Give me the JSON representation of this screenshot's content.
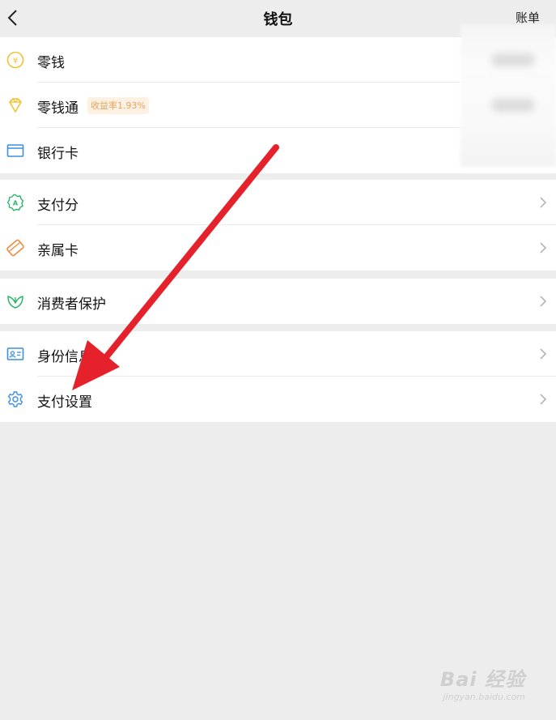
{
  "nav": {
    "title": "钱包",
    "right_action": "账单"
  },
  "sections": [
    {
      "items": [
        {
          "label": "零钱",
          "icon": "coin-icon"
        },
        {
          "label": "零钱通",
          "icon": "diamond-icon",
          "badge": "收益率1.93%"
        },
        {
          "label": "银行卡",
          "icon": "bank-card-icon"
        }
      ]
    },
    {
      "items": [
        {
          "label": "支付分",
          "icon": "payscore-icon"
        },
        {
          "label": "亲属卡",
          "icon": "family-card-icon"
        }
      ]
    },
    {
      "items": [
        {
          "label": "消费者保护",
          "icon": "consumer-protection-icon"
        }
      ]
    },
    {
      "items": [
        {
          "label": "身份信息",
          "icon": "id-card-icon"
        },
        {
          "label": "支付设置",
          "icon": "settings-gear-icon"
        }
      ]
    }
  ],
  "watermark": {
    "main": "Bai 经验",
    "sub": "jingyan.baidu.com"
  },
  "colors": {
    "arrow": "#e5222b",
    "badge_text": "#e6a35c",
    "badge_bg": "#fdf1e3"
  }
}
